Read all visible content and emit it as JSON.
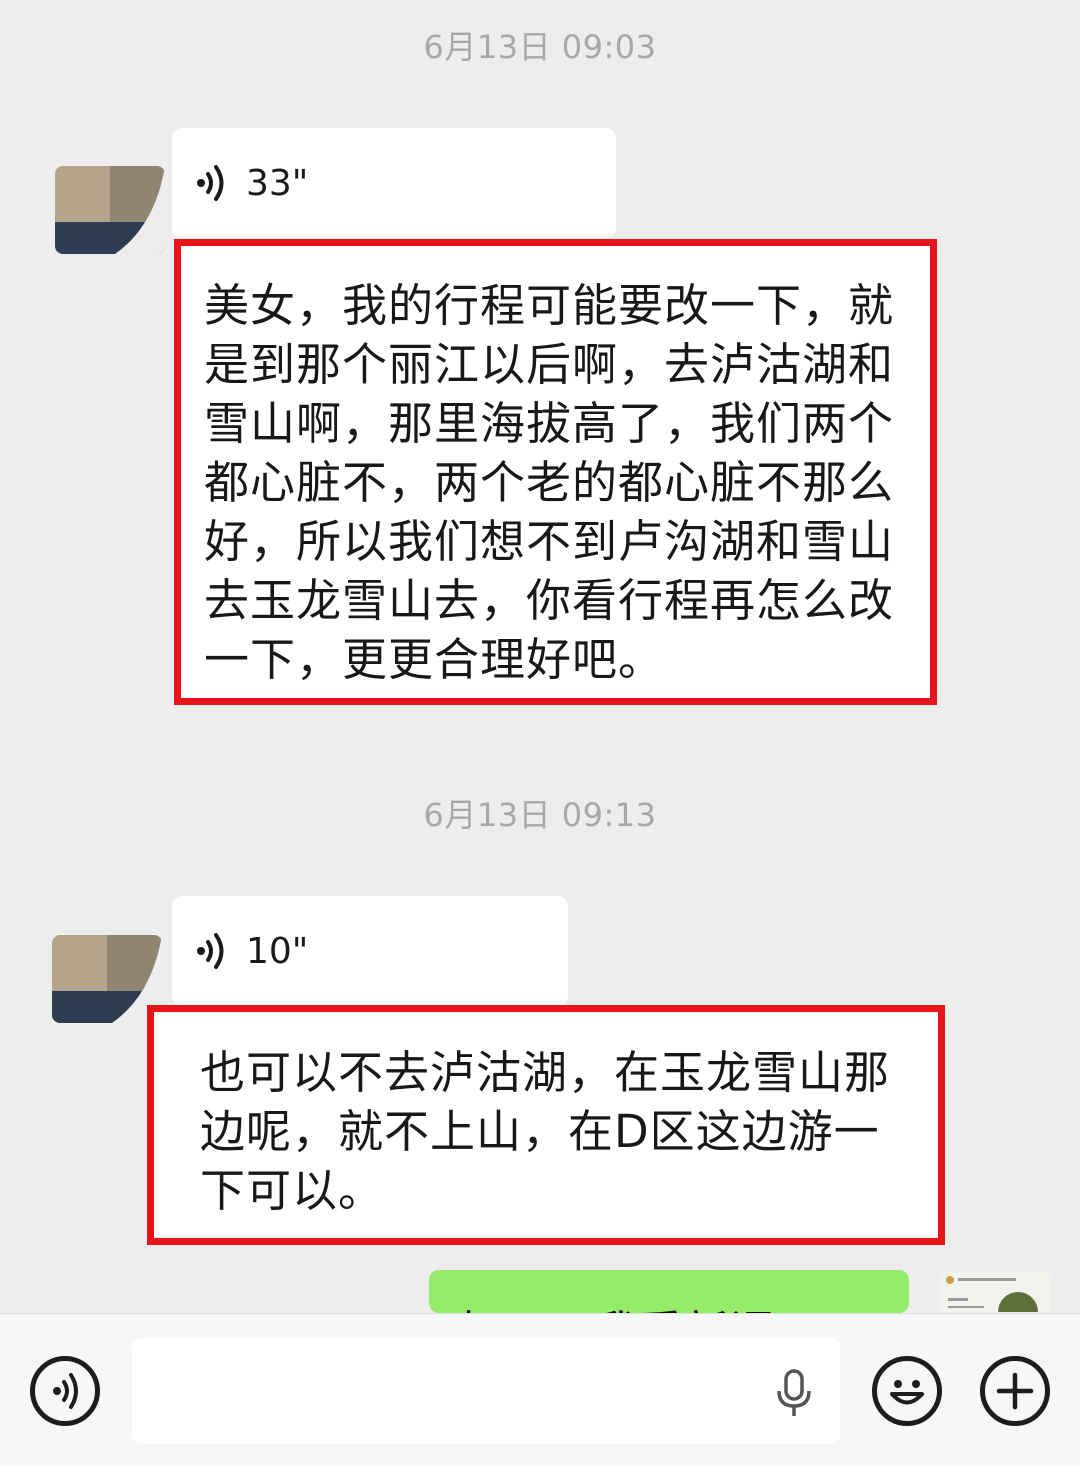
{
  "chat": {
    "messages": [
      {
        "timestamp": "6月13日 09:03",
        "voice_duration": "33\"",
        "transcript": "美女，我的行程可能要改一下，就是到那个丽江以后啊，去泸沽湖和雪山啊，那里海拔高了，我们两个都心脏不，两个老的都心脏不那么好，所以我们想不到卢沟湖和雪山去玉龙雪山去，你看行程再怎么改一下，更更合理好吧。"
      },
      {
        "timestamp": "6月13日 09:13",
        "voice_duration": "10\"",
        "transcript": "也可以不去泸沽湖，在玉龙雪山那边呢，就不上山，在D区这边游一下可以。"
      }
    ],
    "my_reply_partial": "好吧，我重新调一下"
  },
  "colors": {
    "highlight": "#e8141c",
    "my_bubble": "#95ec69",
    "background": "#ededed"
  },
  "icons": {
    "voice_toggle": "voice-mode-icon",
    "mic": "microphone-icon",
    "emoji": "emoji-icon",
    "more": "plus-icon"
  }
}
